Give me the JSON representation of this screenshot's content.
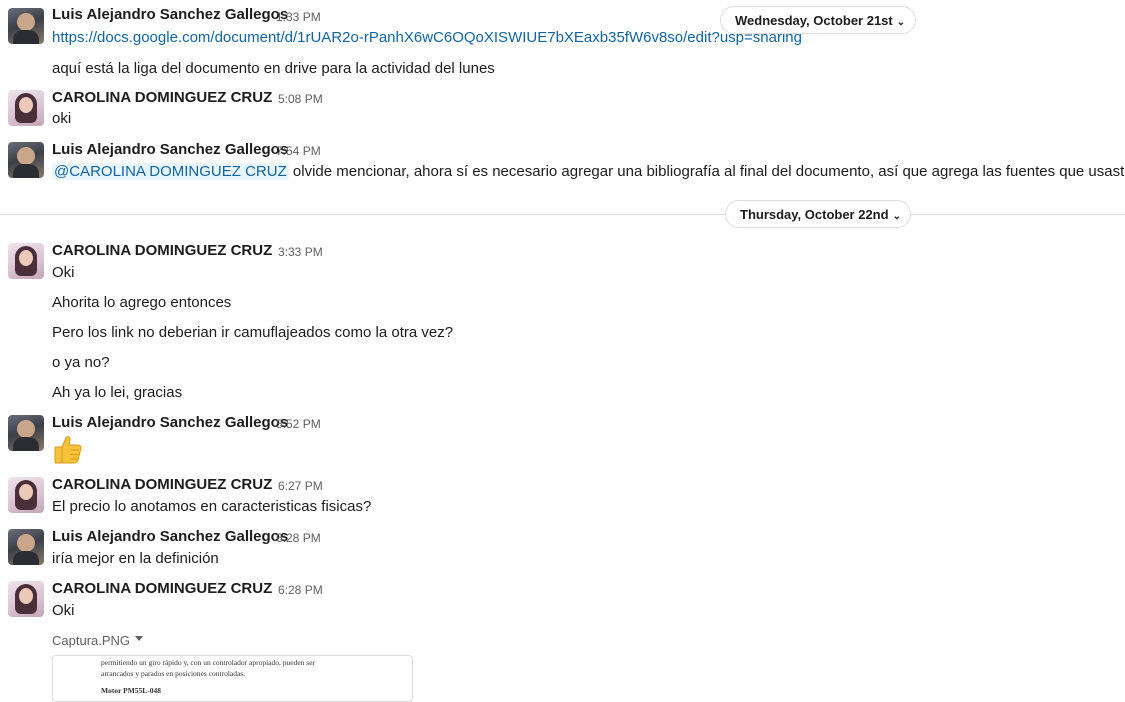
{
  "users": {
    "luis": "Luis Alejandro Sanchez Gallegos",
    "carolina": "CAROLINA DOMINGUEZ CRUZ"
  },
  "dates": {
    "oct21": "Wednesday, October 21st",
    "oct22": "Thursday, October 22nd"
  },
  "messages": [
    {
      "time": "1:33 PM",
      "link": "https://docs.google.com/document/d/1rUAR2o-rPanhX6wC6OQoXISWIUE7bXEaxb35fW6v8so/edit?usp=sharing",
      "text": "aquí está la liga del documento en drive para la actividad del lunes"
    },
    {
      "time": "5:08 PM",
      "text": "oki"
    },
    {
      "time": "7:54 PM",
      "mention": "@CAROLINA DOMINGUEZ CRUZ",
      "text": "olvide mencionar, ahora sí es necesario agregar una bibliografía al final del documento, así que agrega las fuentes que usaste"
    },
    {
      "time": "3:33 PM",
      "lines": [
        "Oki",
        "Ahorita lo agrego entonces",
        "Pero los link no deberian ir camuflajeados como la otra vez?",
        "o ya no?",
        "Ah ya lo lei, gracias"
      ]
    },
    {
      "time": "5:52 PM",
      "emoji": "thumbs-up"
    },
    {
      "time": "6:27 PM",
      "text": "El precio lo anotamos en caracteristicas fisicas?"
    },
    {
      "time": "6:28 PM",
      "text": "iría mejor en la definición"
    },
    {
      "time": "6:28 PM",
      "text": "Oki"
    }
  ],
  "file": {
    "name": "Captura.PNG",
    "preview_lines": [
      "permitiendo un giro rápido y, con un controlador apropiado, pueden ser",
      "arrancados y parados en posiciones controladas.",
      "Motor PM55L-048"
    ]
  }
}
